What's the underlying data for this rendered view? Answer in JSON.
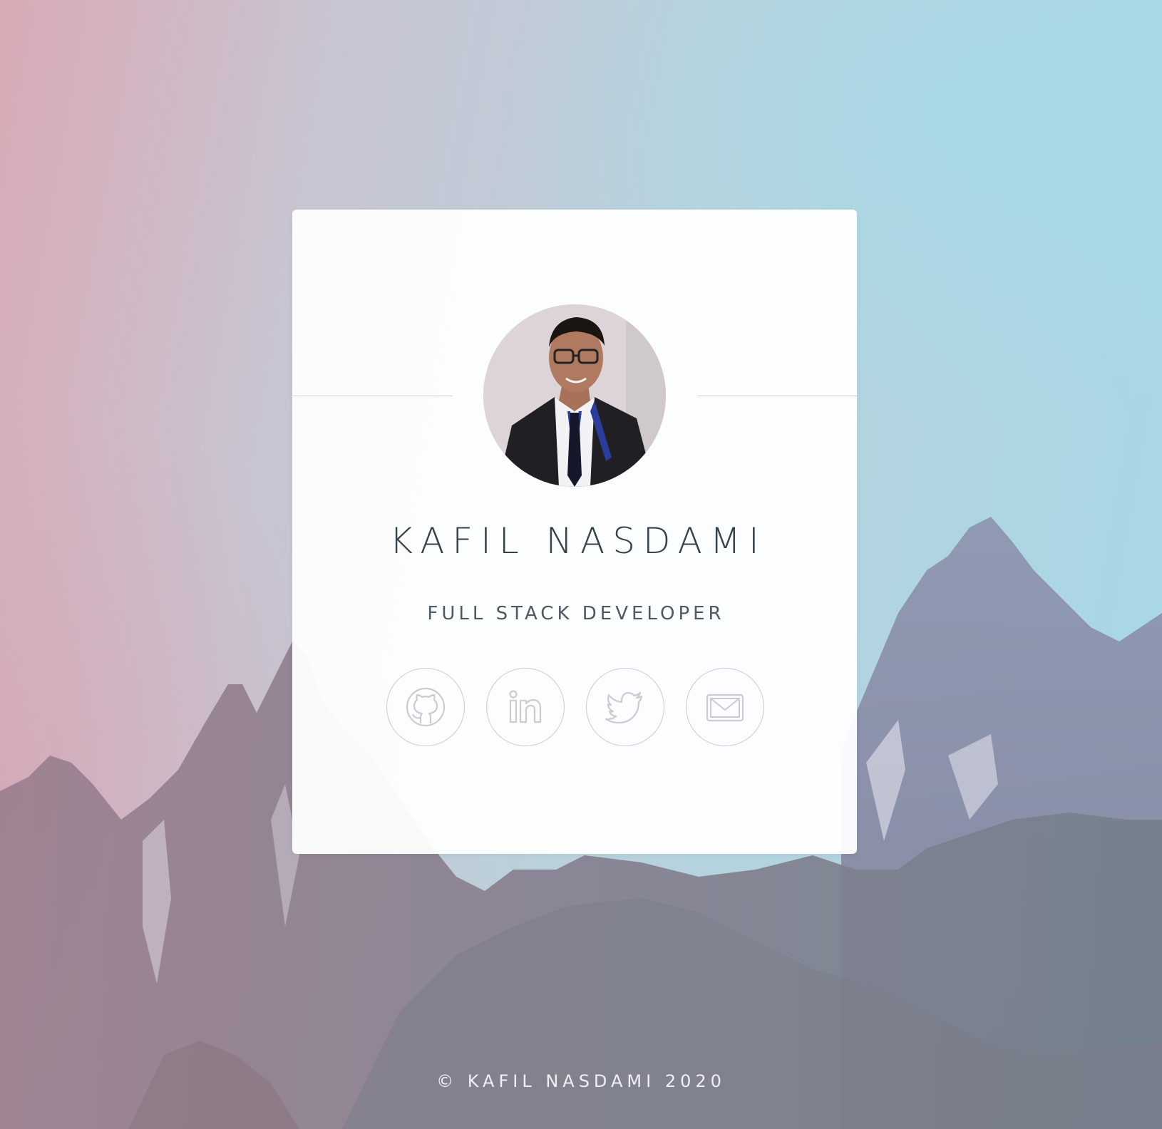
{
  "profile": {
    "name": "KAFIL NASDAMI",
    "role": "FULL STACK DEVELOPER",
    "avatar_alt": "Kafil Nasdami"
  },
  "socials": [
    {
      "name": "github",
      "icon": "github-icon"
    },
    {
      "name": "linkedin",
      "icon": "linkedin-icon"
    },
    {
      "name": "twitter",
      "icon": "twitter-icon"
    },
    {
      "name": "email",
      "icon": "envelope-icon"
    }
  ],
  "footer": {
    "copyright": "© KAFIL NASDAMI 2020"
  },
  "colors": {
    "text_dark": "#34424c",
    "icon_stroke": "#c9cdd1",
    "card_bg": "#ffffff",
    "footer_text": "#eef0f3"
  }
}
